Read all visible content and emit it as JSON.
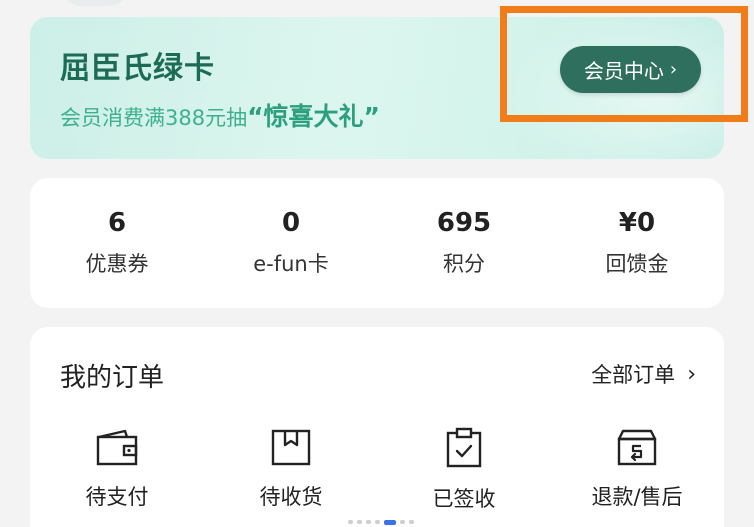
{
  "member_card": {
    "title": "屈臣氏绿卡",
    "subtitle_prefix": "会员消费满388元抽",
    "subtitle_highlight": "“惊喜大礼”",
    "button_label": "会员中心",
    "button_chevron": "›"
  },
  "stats": [
    {
      "value": "6",
      "label": "优惠券"
    },
    {
      "value": "0",
      "label": "e-fun卡"
    },
    {
      "value": "695",
      "label": "积分"
    },
    {
      "value": "¥0",
      "label": "回馈金"
    }
  ],
  "orders": {
    "title": "我的订单",
    "all_label": "全部订单",
    "all_chevron": "›",
    "items": [
      {
        "label": "待支付",
        "icon": "wallet-icon"
      },
      {
        "label": "待收货",
        "icon": "package-icon"
      },
      {
        "label": "已签收",
        "icon": "clipboard-check-icon"
      },
      {
        "label": "退款/售后",
        "icon": "refund-box-icon"
      }
    ]
  },
  "colors": {
    "accent": "#2f6f5d",
    "title_green": "#1d6b55",
    "subtitle_green": "#3fb08f",
    "highlight_border": "#f07d1a"
  }
}
